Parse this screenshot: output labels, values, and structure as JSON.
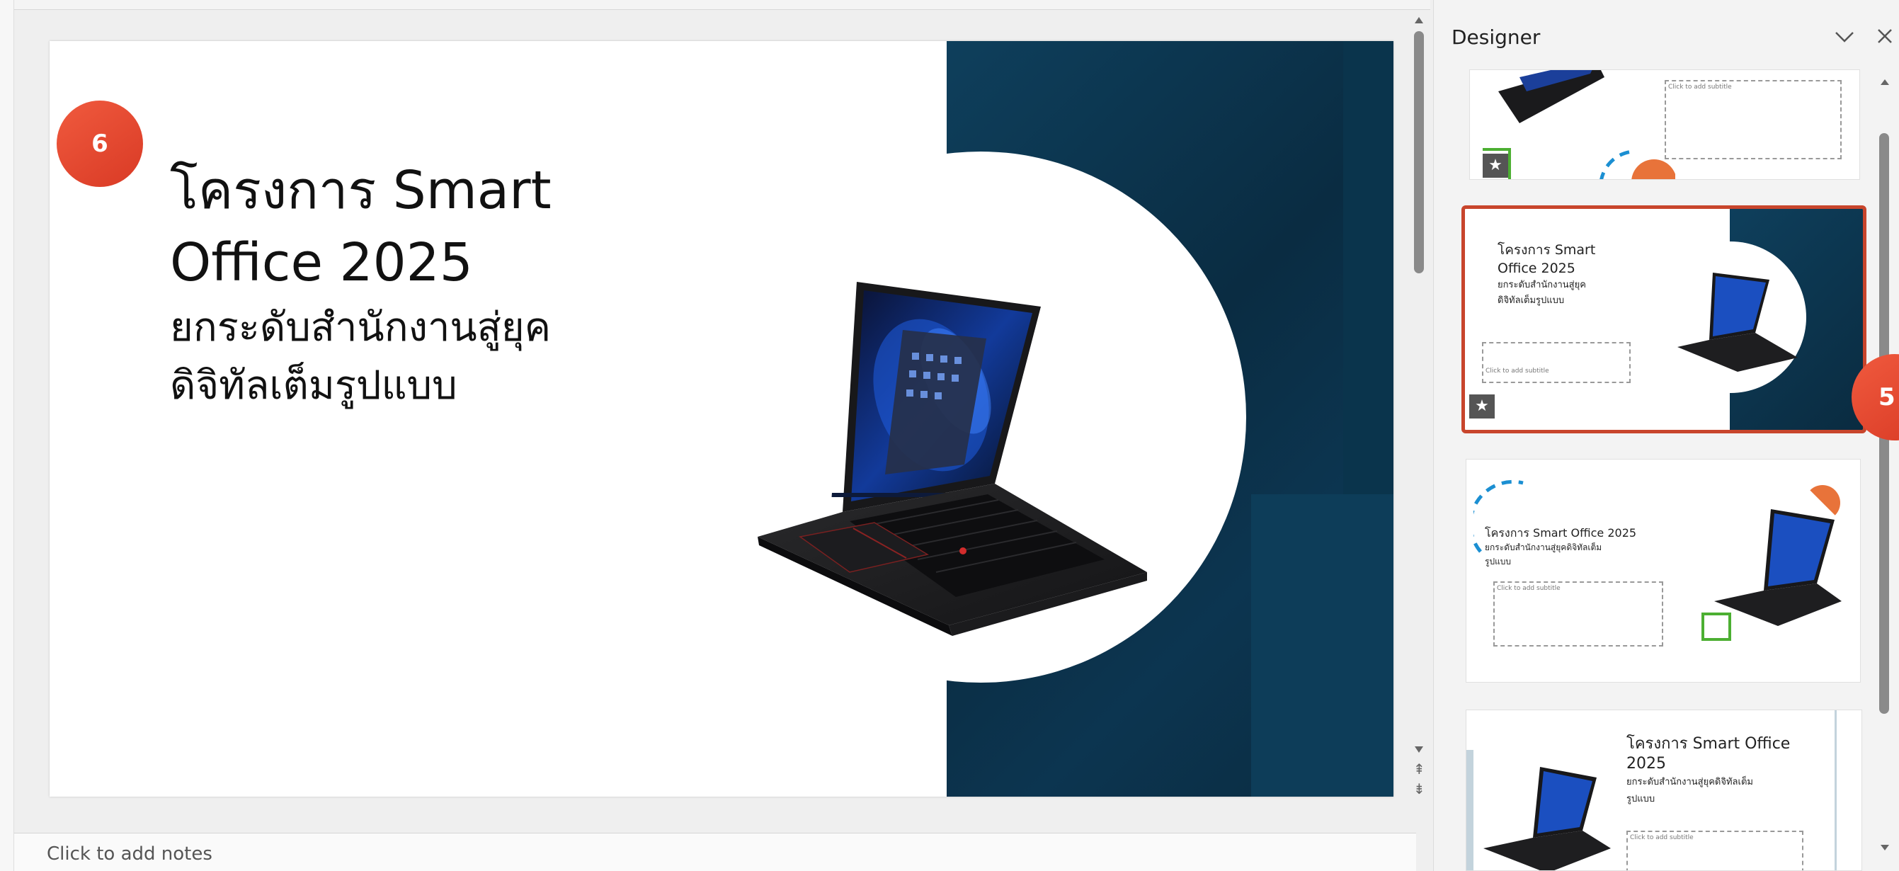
{
  "editor": {
    "slide": {
      "title_line1": "โครงการ Smart",
      "title_line2": "Office 2025",
      "subtitle_line1": "ยกระดับสำนักงานสู่ยุค",
      "subtitle_line2": "ดิจิทัลเต็มรูปแบบ"
    },
    "notes_placeholder": "Click to add notes"
  },
  "badges": {
    "left": "6",
    "right": "5"
  },
  "designer": {
    "title": "Designer",
    "collapse_icon": "chevron-down-icon",
    "close_icon": "close-icon",
    "cards": [
      {
        "subtitle_placeholder": "Click to add subtitle"
      },
      {
        "title": "โครงการ Smart",
        "title2": "Office 2025",
        "subtitle": "ยกระดับสำนักงานสู่ยุค",
        "subtitle2": "ดิจิทัลเต็มรูปแบบ",
        "subtitle_placeholder": "Click to add subtitle"
      },
      {
        "title": "โครงการ Smart Office 2025",
        "subtitle": "ยกระดับสำนักงานสู่ยุคดิจิทัลเต็ม",
        "subtitle2": "รูปแบบ",
        "subtitle_placeholder": "Click to add subtitle"
      },
      {
        "title": "โครงการ Smart Office",
        "title2": "2025",
        "subtitle": "ยกระดับสำนักงานสู่ยุคดิจิทัลเต็ม",
        "subtitle2": "รูปแบบ",
        "subtitle_placeholder": "Click to add subtitle"
      }
    ]
  },
  "colors": {
    "accent": "#c8452c",
    "badge": "#e3482f",
    "slide_dark": "#0b3149",
    "deco_orange": "#e8733a",
    "deco_blue": "#1b8fd2",
    "deco_green": "#4caf32"
  }
}
